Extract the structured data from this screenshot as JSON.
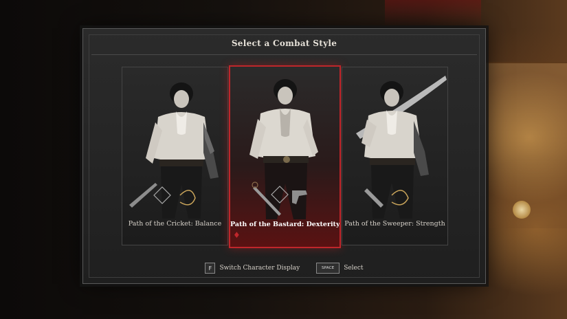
{
  "screen": {
    "title": "Select a Combat Style"
  },
  "cards": [
    {
      "label": "Path of the Cricket: Balance",
      "selected": false,
      "weapons": [
        "dagger-icon",
        "crossbow-icon"
      ]
    },
    {
      "label": "Path of the Bastard: Dexterity",
      "selected": true,
      "weapons": [
        "rapier-icon",
        "pistol-icon"
      ]
    },
    {
      "label": "Path of the Sweeper: Strength",
      "selected": false,
      "weapons": [
        "saber-icon",
        "crossbow-icon"
      ]
    }
  ],
  "footer": {
    "switch_key": "F",
    "switch_label": "Switch Character Display",
    "select_key": "SPACE",
    "select_label": "Select"
  },
  "colors": {
    "accent": "#c0262b",
    "panel": "#262626",
    "text": "#e6e1d8"
  }
}
